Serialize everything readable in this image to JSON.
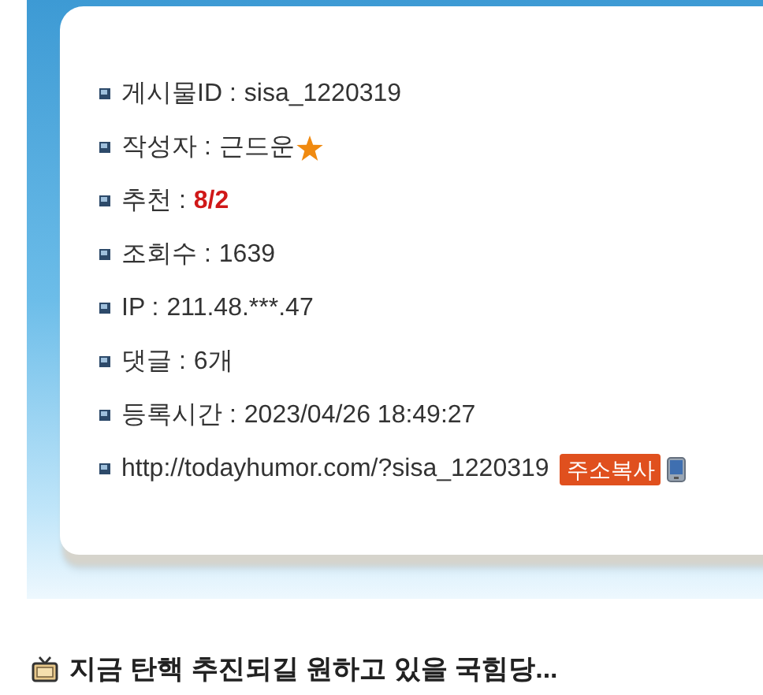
{
  "post_info": [
    {
      "kind": "text",
      "label": "게시물ID :",
      "value": "sisa_1220319"
    },
    {
      "kind": "author",
      "label": "작성자 :",
      "value": "근드운"
    },
    {
      "kind": "recommend",
      "label": "추천 :",
      "value": "8/2"
    },
    {
      "kind": "text",
      "label": "조회수 :",
      "value": "1639"
    },
    {
      "kind": "text",
      "label": "IP :",
      "value": "211.48.***.47"
    },
    {
      "kind": "text",
      "label": "댓글 :",
      "value": "6개"
    },
    {
      "kind": "text",
      "label": "등록시간 :",
      "value": "2023/04/26 18:49:27"
    },
    {
      "kind": "link",
      "value": "http://todayhumor.com/?sisa_1220319",
      "button": "주소복사"
    }
  ],
  "next_post": {
    "title": "지금 탄핵 추진되길 원하고 있을 국힘당..."
  }
}
